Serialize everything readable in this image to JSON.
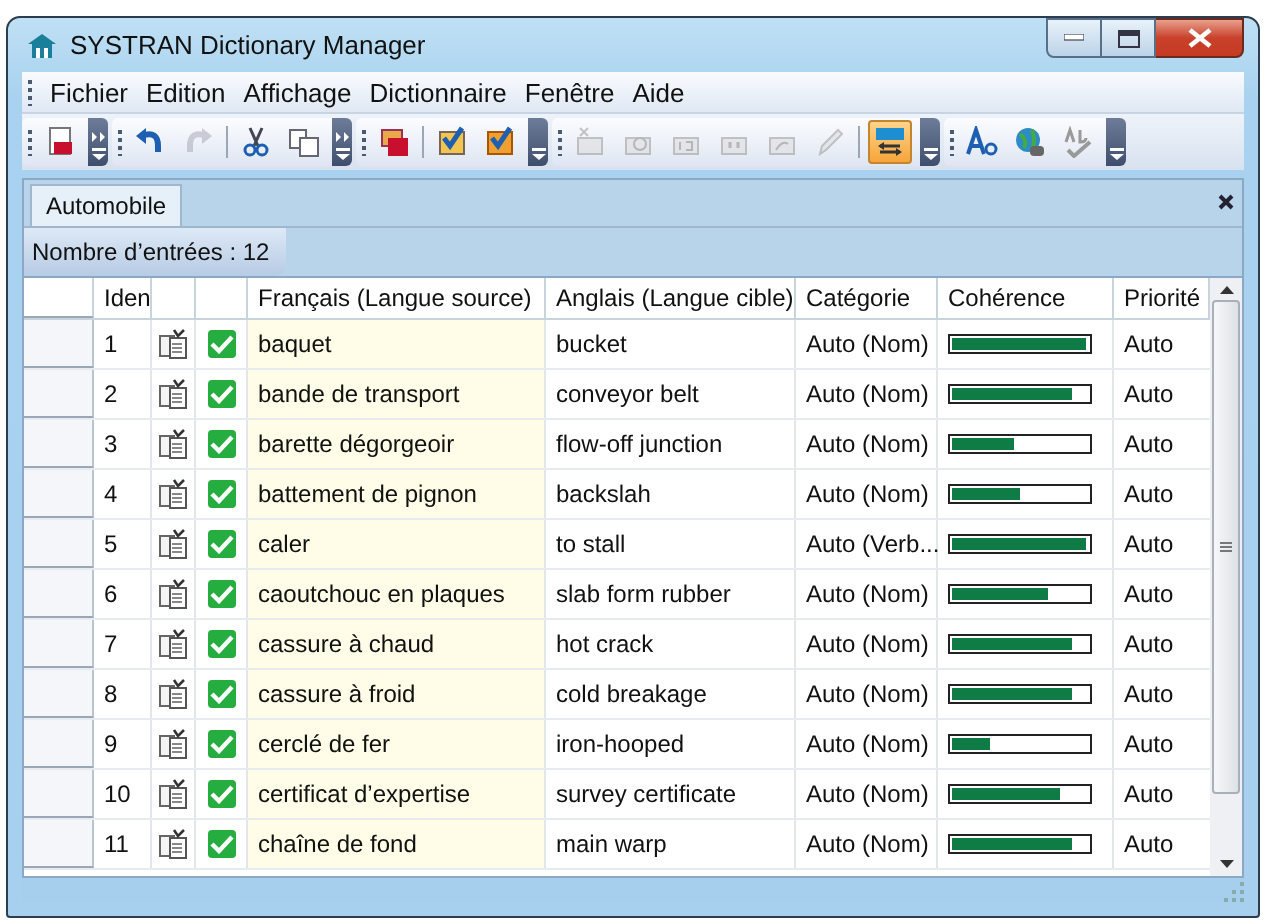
{
  "window": {
    "title": "SYSTRAN Dictionary Manager"
  },
  "menu": [
    "Fichier",
    "Edition",
    "Affichage",
    "Dictionnaire",
    "Fenêtre",
    "Aide"
  ],
  "toolbar": [
    {
      "buttons": [
        {
          "selected": false,
          "disabled": false
        }
      ],
      "overflow": true
    },
    {
      "buttons": [
        {
          "selected": false,
          "disabled": false
        },
        {
          "selected": false,
          "disabled": true
        },
        {
          "selected": false,
          "disabled": false
        },
        {
          "selected": false,
          "disabled": false
        }
      ],
      "overflow": true
    },
    {
      "buttons": [
        {
          "selected": false,
          "disabled": false
        },
        {
          "selected": false,
          "disabled": false
        },
        {
          "selected": false,
          "disabled": false
        }
      ],
      "overflow": false
    },
    {
      "buttons": [
        {
          "selected": false,
          "disabled": true
        },
        {
          "selected": false,
          "disabled": true
        },
        {
          "selected": false,
          "disabled": true
        },
        {
          "selected": false,
          "disabled": true
        },
        {
          "selected": false,
          "disabled": true
        },
        {
          "selected": false,
          "disabled": true
        },
        {
          "selected": true,
          "disabled": false
        }
      ],
      "overflow": false
    },
    {
      "buttons": [
        {
          "selected": false,
          "disabled": false
        },
        {
          "selected": false,
          "disabled": false
        },
        {
          "selected": false,
          "disabled": false
        }
      ],
      "overflow": false
    }
  ],
  "tabs": [
    {
      "label": "Automobile",
      "selected": true
    }
  ],
  "entry_count": "Nombre d’entrées : 12",
  "table": {
    "columns": [
      "Iden",
      "Français (Langue source)",
      "Anglais (Langue cible)",
      "Catégorie",
      "Cohérence",
      "Priorité"
    ],
    "rows": [
      {
        "id": "1",
        "checked": true,
        "source": "baquet",
        "target": "bucket",
        "category": "Auto (Nom)",
        "level": 0.98,
        "priority": "Auto"
      },
      {
        "id": "2",
        "checked": true,
        "source": "bande de transport",
        "target": "conveyor belt",
        "category": "Auto (Nom)",
        "level": 0.88,
        "priority": "Auto"
      },
      {
        "id": "3",
        "checked": true,
        "source": "barette dégorgeoir",
        "target": "flow-off junction",
        "category": "Auto (Nom)",
        "level": 0.45,
        "priority": "Auto"
      },
      {
        "id": "4",
        "checked": true,
        "source": "battement de pignon",
        "target": "backslah",
        "category": "Auto (Nom)",
        "level": 0.5,
        "priority": "Auto"
      },
      {
        "id": "5",
        "checked": true,
        "source": "caler",
        "target": "to stall",
        "category": "Auto  (Verb...",
        "level": 0.98,
        "priority": "Auto"
      },
      {
        "id": "6",
        "checked": true,
        "source": "caoutchouc en plaques",
        "target": "slab form rubber",
        "category": "Auto (Nom)",
        "level": 0.7,
        "priority": "Auto"
      },
      {
        "id": "7",
        "checked": true,
        "source": "cassure à chaud",
        "target": "hot crack",
        "category": "Auto (Nom)",
        "level": 0.88,
        "priority": "Auto"
      },
      {
        "id": "8",
        "checked": true,
        "source": "cassure à froid",
        "target": "cold breakage",
        "category": "Auto (Nom)",
        "level": 0.88,
        "priority": "Auto"
      },
      {
        "id": "9",
        "checked": true,
        "source": "cerclé de fer",
        "target": "iron-hooped",
        "category": "Auto (Nom)",
        "level": 0.28,
        "priority": "Auto"
      },
      {
        "id": "10",
        "checked": true,
        "source": "certificat d’expertise",
        "target": "survey certificate",
        "category": "Auto (Nom)",
        "level": 0.8,
        "priority": "Auto"
      },
      {
        "id": "11",
        "checked": true,
        "source": "chaîne de fond",
        "target": "main warp",
        "category": "Auto (Nom)",
        "level": 0.88,
        "priority": "Auto"
      }
    ]
  }
}
